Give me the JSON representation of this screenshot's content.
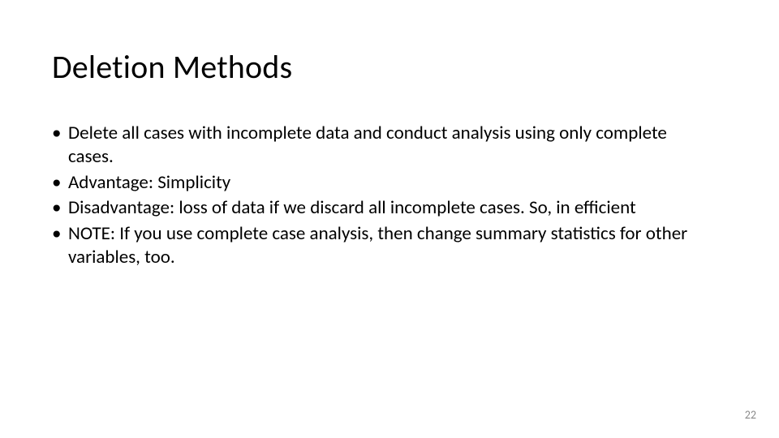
{
  "slide": {
    "title": "Deletion Methods",
    "bullets": [
      "Delete all cases with incomplete data and conduct analysis using only complete cases.",
      "Advantage: Simplicity",
      "Disadvantage: loss of data if we discard all incomplete cases. So, in efficient",
      "NOTE: If you use complete case analysis, then change summary statistics for other variables, too."
    ],
    "page_number": "22"
  }
}
